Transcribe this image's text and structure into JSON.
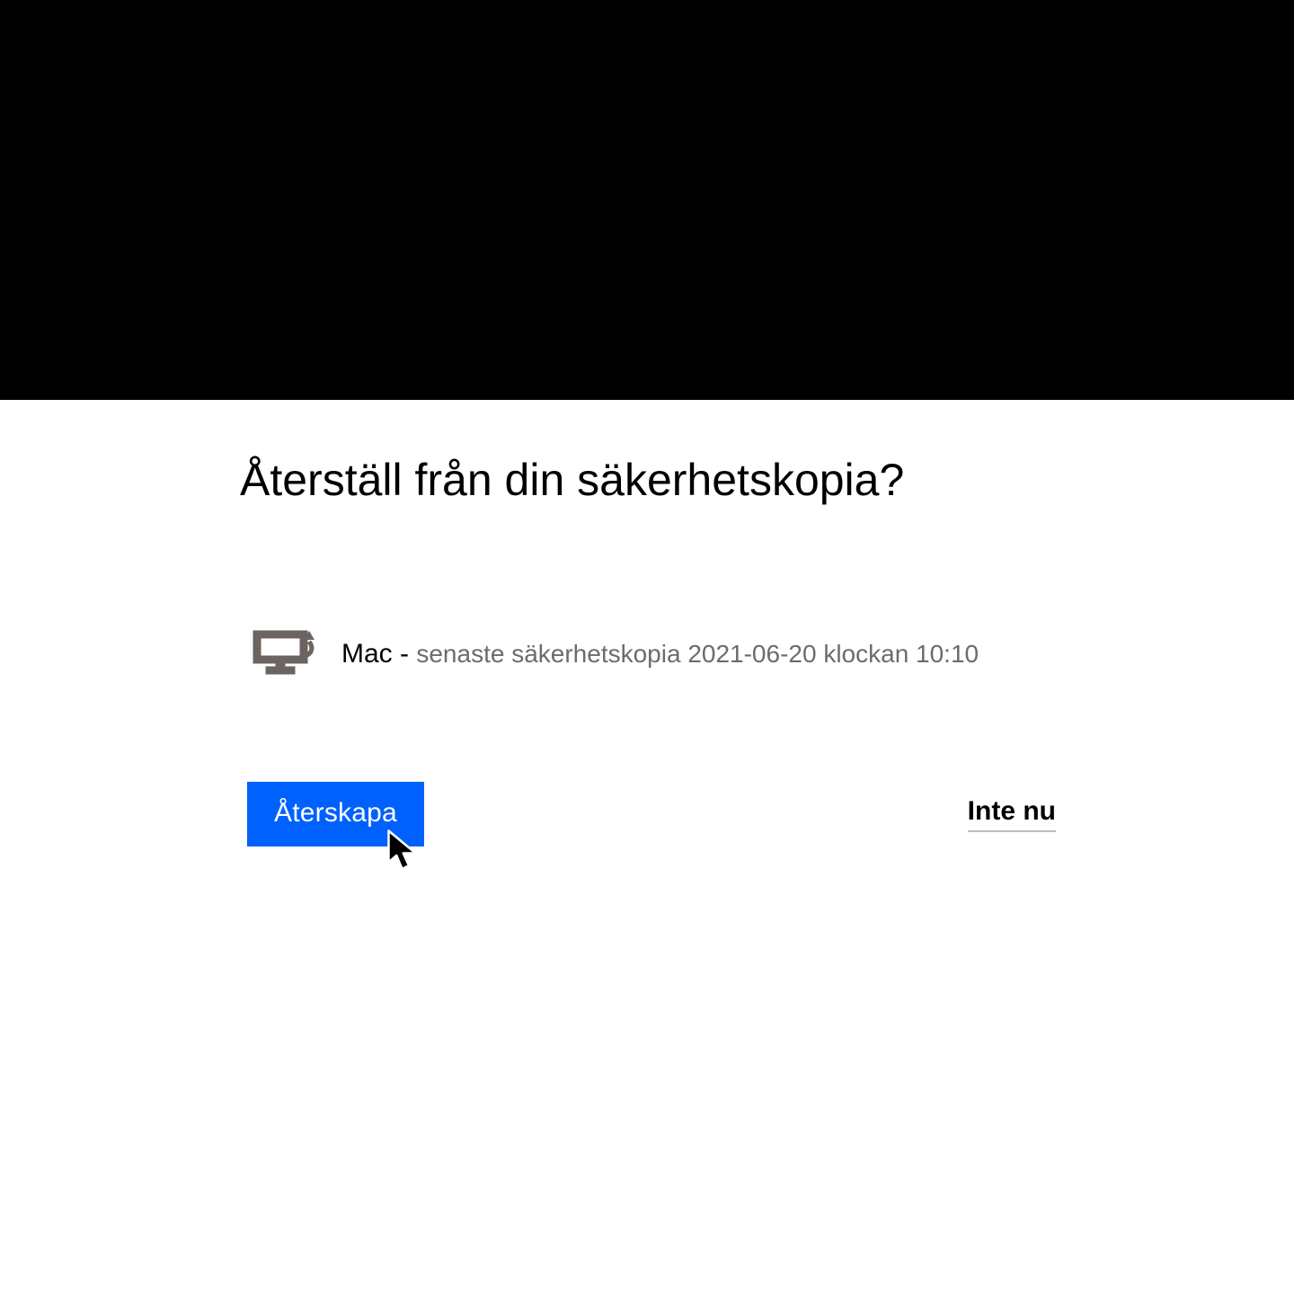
{
  "dialog": {
    "title": "Återställ från din säkerhetskopia?",
    "backup": {
      "device_name": "Mac",
      "separator": " - ",
      "last_backup_text": "senaste säkerhetskopia 2021-06-20 klockan 10:10"
    },
    "actions": {
      "primary_label": "Återskapa",
      "secondary_label": "Inte nu"
    }
  },
  "colors": {
    "primary": "#0061fe",
    "black": "#000000",
    "muted": "#6c6c6c",
    "underline": "#bdbdbd"
  }
}
